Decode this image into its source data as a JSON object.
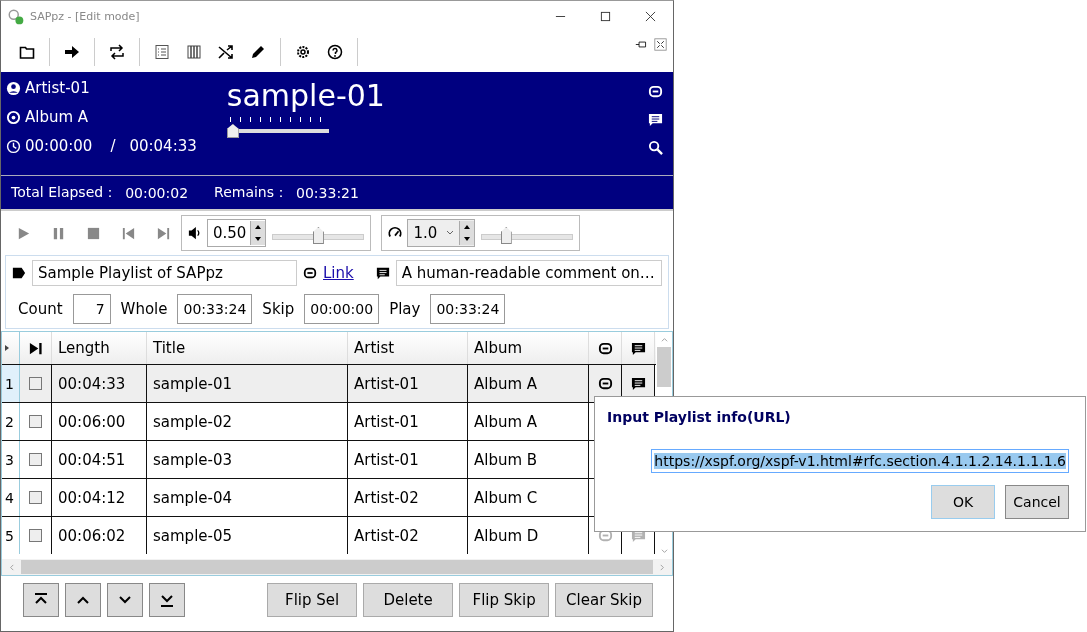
{
  "window": {
    "title": "SAPpz - [Edit mode]"
  },
  "now_playing": {
    "artist": "Artist-01",
    "album": "Album A",
    "elapsed": "00:00:00",
    "separator": "/",
    "duration": "00:04:33",
    "title": "sample-01",
    "level": 0
  },
  "totals": {
    "elapsed_label": "Total Elapsed：",
    "elapsed": "00:00:02",
    "remains_label": "Remains：",
    "remains": "00:33:21"
  },
  "volume": {
    "value": "0.50",
    "level": 0.5
  },
  "speed": {
    "value": "1.0",
    "level": 0.24
  },
  "playlist": {
    "title": "Sample Playlist of SAPpz",
    "link": "Link",
    "comment": "A human-readable comment on…",
    "count_label": "Count",
    "count": "7",
    "whole_label": "Whole",
    "whole": "00:33:24",
    "skip_label": "Skip",
    "skip": "00:00:00",
    "play_label": "Play",
    "play": "00:33:24"
  },
  "table": {
    "columns": [
      "Length",
      "Title",
      "Artist",
      "Album"
    ],
    "rows": [
      {
        "index": "1",
        "checked": false,
        "selected": true,
        "length": "00:04:33",
        "title": "sample-01",
        "artist": "Artist-01",
        "album": "Album A"
      },
      {
        "index": "2",
        "checked": false,
        "selected": false,
        "length": "00:06:00",
        "title": "sample-02",
        "artist": "Artist-01",
        "album": "Album A"
      },
      {
        "index": "3",
        "checked": false,
        "selected": false,
        "length": "00:04:51",
        "title": "sample-03",
        "artist": "Artist-01",
        "album": "Album B"
      },
      {
        "index": "4",
        "checked": false,
        "selected": false,
        "length": "00:04:12",
        "title": "sample-04",
        "artist": "Artist-02",
        "album": "Album C"
      },
      {
        "index": "5",
        "checked": false,
        "selected": false,
        "length": "00:06:02",
        "title": "sample-05",
        "artist": "Artist-02",
        "album": "Album D"
      }
    ]
  },
  "buttons": [
    "Flip Sel",
    "Delete",
    "Flip Skip",
    "Clear Skip"
  ],
  "dialog": {
    "title": "Input Playlist info(URL)",
    "value": "https://xspf.org/xspf-v1.html#rfc.section.4.1.1.2.14.1.1.1.6",
    "buttons": [
      "OK",
      "Cancel"
    ]
  }
}
